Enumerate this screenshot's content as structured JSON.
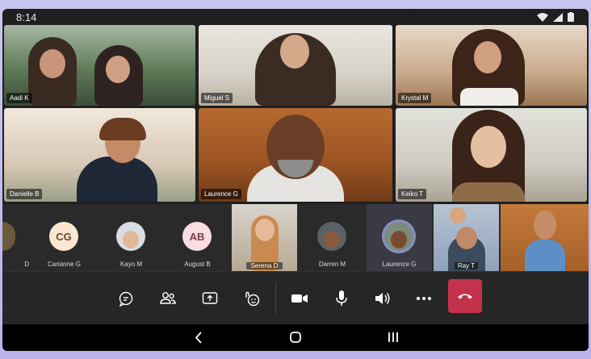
{
  "status_bar": {
    "time": "8:14"
  },
  "video_grid": [
    {
      "name": "Aadi K"
    },
    {
      "name": "Miguel S"
    },
    {
      "name": "Krystal M"
    },
    {
      "name": "Danielle B"
    },
    {
      "name": "Laurence G"
    },
    {
      "name": "Keiko T"
    }
  ],
  "roster": [
    {
      "name": "D"
    },
    {
      "name": "Carianne G",
      "initials": "CG"
    },
    {
      "name": "Kayo M"
    },
    {
      "name": "August B",
      "initials": "AB"
    },
    {
      "name": "Serena D"
    },
    {
      "name": "Darren M"
    },
    {
      "name": "Laurence G",
      "speaking": true
    },
    {
      "name": "Ray T"
    },
    {
      "name": ""
    }
  ],
  "controls": {
    "chat": "chat-icon",
    "people": "people-icon",
    "share": "share-screen-icon",
    "reactions": "reactions-icon",
    "camera": "camera-icon",
    "mic": "microphone-icon",
    "speaker": "speaker-icon",
    "more": "more-icon",
    "hangup": "hang-up-icon"
  },
  "colors": {
    "hangup": "#c4314b",
    "speaking_ring": "#8b8cc7"
  }
}
